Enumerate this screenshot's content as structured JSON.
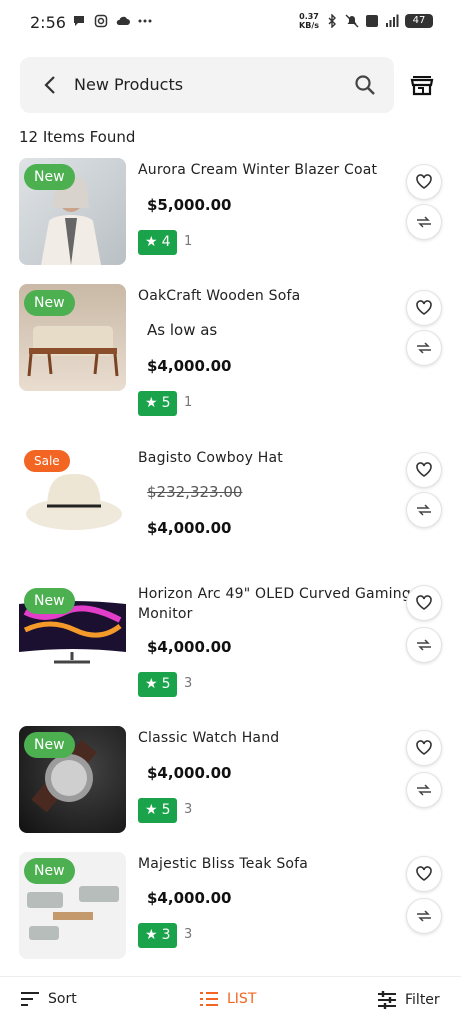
{
  "status": {
    "time": "2:56",
    "speed_top": "0.37",
    "speed_unit": "KB/s",
    "battery": "47",
    "left_icons": [
      "chat-icon",
      "instagram-icon",
      "cloud-icon",
      "more-icon"
    ],
    "right_icons": [
      "bluetooth-icon",
      "mute-icon",
      "volte-icon",
      "signal-icon",
      "battery-icon"
    ]
  },
  "header": {
    "title": "New Products",
    "back_icon": "chevron-left-icon",
    "search_icon": "search-icon",
    "store_icon": "store-icon"
  },
  "results": {
    "count_text": "12 Items Found"
  },
  "products": [
    {
      "name": "Aurora Cream Winter Blazer Coat",
      "badge": "New",
      "price": "$5,000.00",
      "rating": "4",
      "reviews": "1"
    },
    {
      "name": "OakCraft Wooden Sofa",
      "badge": "New",
      "prefix": "As low as",
      "price": "$4,000.00",
      "rating": "5",
      "reviews": "1"
    },
    {
      "name": "Bagisto Cowboy Hat",
      "badge": "Sale",
      "old_price": "$232,323.00",
      "price": "$4,000.00"
    },
    {
      "name": "Horizon Arc 49\" OLED Curved Gaming Monitor",
      "badge": "New",
      "price": "$4,000.00",
      "rating": "5",
      "reviews": "3"
    },
    {
      "name": "Classic Watch Hand",
      "badge": "New",
      "price": "$4,000.00",
      "rating": "5",
      "reviews": "3"
    },
    {
      "name": "Majestic Bliss Teak Sofa",
      "badge": "New",
      "price": "$4,000.00",
      "rating": "3",
      "reviews": "3"
    }
  ],
  "bottom": {
    "sort": "Sort",
    "list": "LIST",
    "filter": "Filter"
  },
  "colors": {
    "accent": "#f26522",
    "new_badge": "#4caf50",
    "rating": "#1aa34a"
  }
}
